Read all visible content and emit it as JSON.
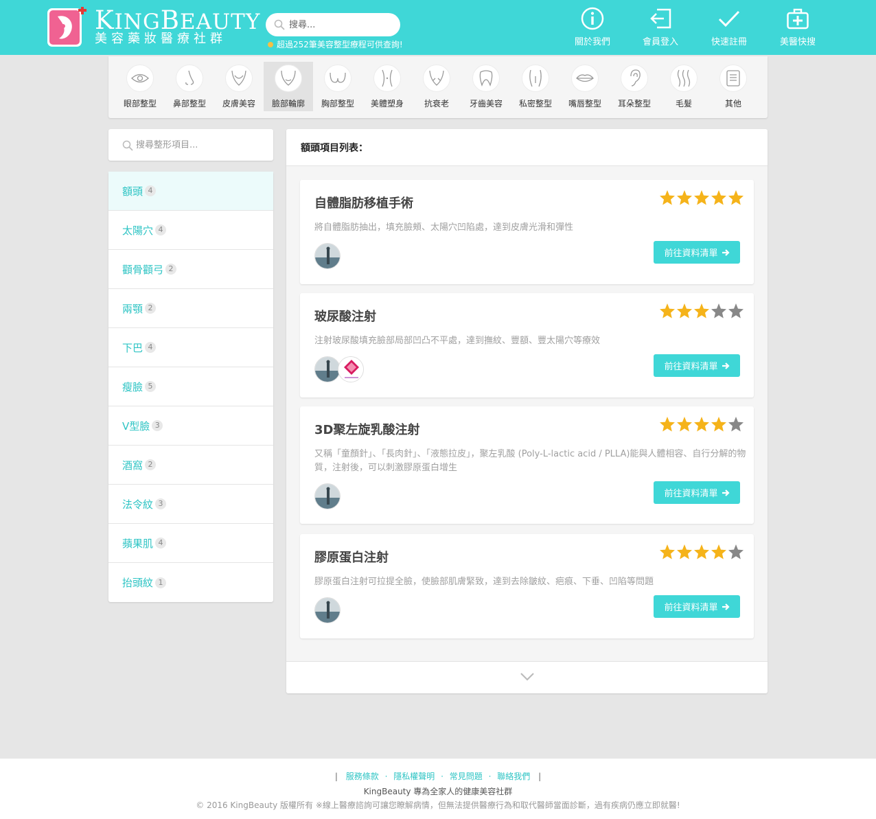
{
  "header": {
    "brand_en_first": "K",
    "brand_en_rest1": "ING",
    "brand_en_b": "B",
    "brand_en_rest2": "EAUTY",
    "brand_zh": "美容藥妝醫療社群",
    "search_placeholder": "搜尋...",
    "search_hint": "超過252筆美容整型療程可供查詢!",
    "nav": [
      {
        "label": "關於我們",
        "icon": "info-icon"
      },
      {
        "label": "會員登入",
        "icon": "login-icon"
      },
      {
        "label": "快速註冊",
        "icon": "check-icon"
      },
      {
        "label": "美醫快搜",
        "icon": "medkit-icon"
      }
    ],
    "colors": {
      "primary": "#3fd7d7",
      "logo_pink": "#f06292",
      "hint_dot": "#f5c044"
    }
  },
  "categories": [
    {
      "label": "眼部整型",
      "icon": "eye-icon"
    },
    {
      "label": "鼻部整型",
      "icon": "nose-icon"
    },
    {
      "label": "皮膚美容",
      "icon": "skin-icon"
    },
    {
      "label": "臉部輪廓",
      "icon": "face-contour-icon",
      "active": true
    },
    {
      "label": "胸部整型",
      "icon": "chest-icon"
    },
    {
      "label": "美體塑身",
      "icon": "body-icon"
    },
    {
      "label": "抗衰老",
      "icon": "anti-aging-icon"
    },
    {
      "label": "牙齒美容",
      "icon": "tooth-icon"
    },
    {
      "label": "私密整型",
      "icon": "private-icon"
    },
    {
      "label": "嘴唇整型",
      "icon": "lips-icon"
    },
    {
      "label": "耳朵整型",
      "icon": "ear-icon"
    },
    {
      "label": "毛髮",
      "icon": "hair-icon"
    },
    {
      "label": "其他",
      "icon": "other-icon"
    }
  ],
  "sidebar": {
    "search_placeholder": "搜尋整形項目...",
    "items": [
      {
        "name": "額頭",
        "count": "4",
        "active": true
      },
      {
        "name": "太陽穴",
        "count": "4"
      },
      {
        "name": "顴骨顴弓",
        "count": "2"
      },
      {
        "name": "兩顎",
        "count": "2"
      },
      {
        "name": "下巴",
        "count": "4"
      },
      {
        "name": "瘦臉",
        "count": "5"
      },
      {
        "name": "V型臉",
        "count": "3"
      },
      {
        "name": "酒窩",
        "count": "2"
      },
      {
        "name": "法令紋",
        "count": "3"
      },
      {
        "name": "蘋果肌",
        "count": "4"
      },
      {
        "name": "抬頭紋",
        "count": "1"
      }
    ]
  },
  "main": {
    "heading": "額頭項目列表：",
    "cards": [
      {
        "title": "自體脂肪移植手術",
        "desc": "將自體脂肪抽出，填充臉頰、太陽穴凹陷處，達到皮膚光滑和彈性",
        "rating": 5,
        "button": "前往資料清單",
        "avatars": 1
      },
      {
        "title": "玻尿酸注射",
        "desc": "注射玻尿酸填充臉部局部凹凸不平處，達到撫紋、豐額、豐太陽穴等療效",
        "rating": 3,
        "button": "前往資料清單",
        "avatars": 2
      },
      {
        "title": "3D聚左旋乳酸注射",
        "desc": "又稱「童顏針」、「長肉針」、「液態拉皮」，聚左乳酸 (Poly-L-lactic acid / PLLA)能與人體相容、自行分解的物質，注射後，可以刺激膠原蛋白增生",
        "rating": 4,
        "button": "前往資料清單",
        "avatars": 1
      },
      {
        "title": "膠原蛋白注射",
        "desc": "膠原蛋白注射可拉提全臉，使臉部肌膚緊致，達到去除皺紋、疤痕、下垂、凹陷等問題",
        "rating": 4,
        "button": "前往資料清單",
        "avatars": 1
      }
    ],
    "colors": {
      "star_on": "#f5b31a",
      "star_off": "#888888"
    }
  },
  "footer": {
    "sep": "|",
    "dot": "·",
    "links": [
      "服務條款",
      "隱私權聲明",
      "常見問題",
      "聯絡我們"
    ],
    "line2": "KingBeauty 專為全家人的健康美容社群",
    "line3": "© 2016 KingBeauty 版權所有 ※線上醫療諮詢可讓您瞭解病情，但無法提供醫療行為和取代醫師當面診斷，過有疾病仍應立即就醫!"
  }
}
